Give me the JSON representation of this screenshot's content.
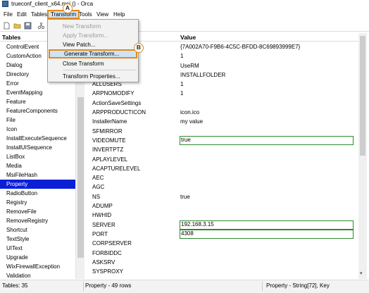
{
  "window": {
    "title": "trueconf_client_x64.msi () - Orca"
  },
  "menubar": [
    {
      "label": "File",
      "name": "menu-file"
    },
    {
      "label": "Edit",
      "name": "menu-edit"
    },
    {
      "label": "Tables",
      "name": "menu-tables"
    },
    {
      "label": "Transform",
      "name": "menu-transform"
    },
    {
      "label": "Tools",
      "name": "menu-tools"
    },
    {
      "label": "View",
      "name": "menu-view"
    },
    {
      "label": "Help",
      "name": "menu-help"
    }
  ],
  "transform_menu": {
    "new_transform": "New Transform",
    "apply_transform": "Apply Transform...",
    "view_patch": "View Patch...",
    "generate_transform": "Generate Transform...",
    "close_transform": "Close Transform",
    "transform_properties": "Transform Properties..."
  },
  "callouts": {
    "a": "A",
    "b": "B"
  },
  "tables_panel": {
    "header": "Tables",
    "items": [
      "ControlEvent",
      "CustomAction",
      "Dialog",
      "Directory",
      "Error",
      "EventMapping",
      "Feature",
      "FeatureComponents",
      "File",
      "Icon",
      "InstallExecuteSequence",
      "InstallUISequence",
      "ListBox",
      "Media",
      "MsiFileHash",
      "Property",
      "RadioButton",
      "Registry",
      "RemoveFile",
      "RemoveRegistry",
      "Shortcut",
      "TextStyle",
      "UIText",
      "Upgrade",
      "WixFirewallException",
      "Validation"
    ],
    "selected": "Property"
  },
  "grid": {
    "col_name": "",
    "col_value": "Value",
    "rows": [
      {
        "name": "",
        "value": "{7A002A70-F9B6-4C5C-BFDD-8C69893999E7}"
      },
      {
        "name": "ORTCUT",
        "value": "1"
      },
      {
        "name": "",
        "value": "UseRM"
      },
      {
        "name": "",
        "value": "INSTALLFOLDER"
      },
      {
        "name": "ALLUSERS",
        "value": "1"
      },
      {
        "name": "ARPNOMODIFY",
        "value": "1"
      },
      {
        "name": "ActionSaveSettings",
        "value": ""
      },
      {
        "name": "ARPPRODUCTICON",
        "value": "icon.ico"
      },
      {
        "name": "InstallerName",
        "value": "my value"
      },
      {
        "name": "SFMIRROR",
        "value": ""
      },
      {
        "name": "VIDEOMUTE",
        "value": "true",
        "highlight": true
      },
      {
        "name": "INVERTPTZ",
        "value": ""
      },
      {
        "name": "APLAYLEVEL",
        "value": ""
      },
      {
        "name": "ACAPTURELEVEL",
        "value": ""
      },
      {
        "name": "AEC",
        "value": ""
      },
      {
        "name": "AGC",
        "value": ""
      },
      {
        "name": "NS",
        "value": "true"
      },
      {
        "name": "ADUMP",
        "value": ""
      },
      {
        "name": "HWHID",
        "value": ""
      },
      {
        "name": "SERVER",
        "value": "192.168.3.15",
        "highlight": true
      },
      {
        "name": "PORT",
        "value": "4308",
        "highlight": true
      },
      {
        "name": "CORPSERVER",
        "value": ""
      },
      {
        "name": "FORBIDDC",
        "value": ""
      },
      {
        "name": "ASKSRV",
        "value": ""
      },
      {
        "name": "SYSPROXY",
        "value": ""
      }
    ]
  },
  "statusbar": {
    "tables": "Tables: 35",
    "rows": "Property - 49 rows",
    "column": "Property - String[72], Key"
  },
  "colors": {
    "selection": "#0a1fd6",
    "callout_border": "#e08a1a",
    "highlight_border": "#2c8a2c"
  }
}
